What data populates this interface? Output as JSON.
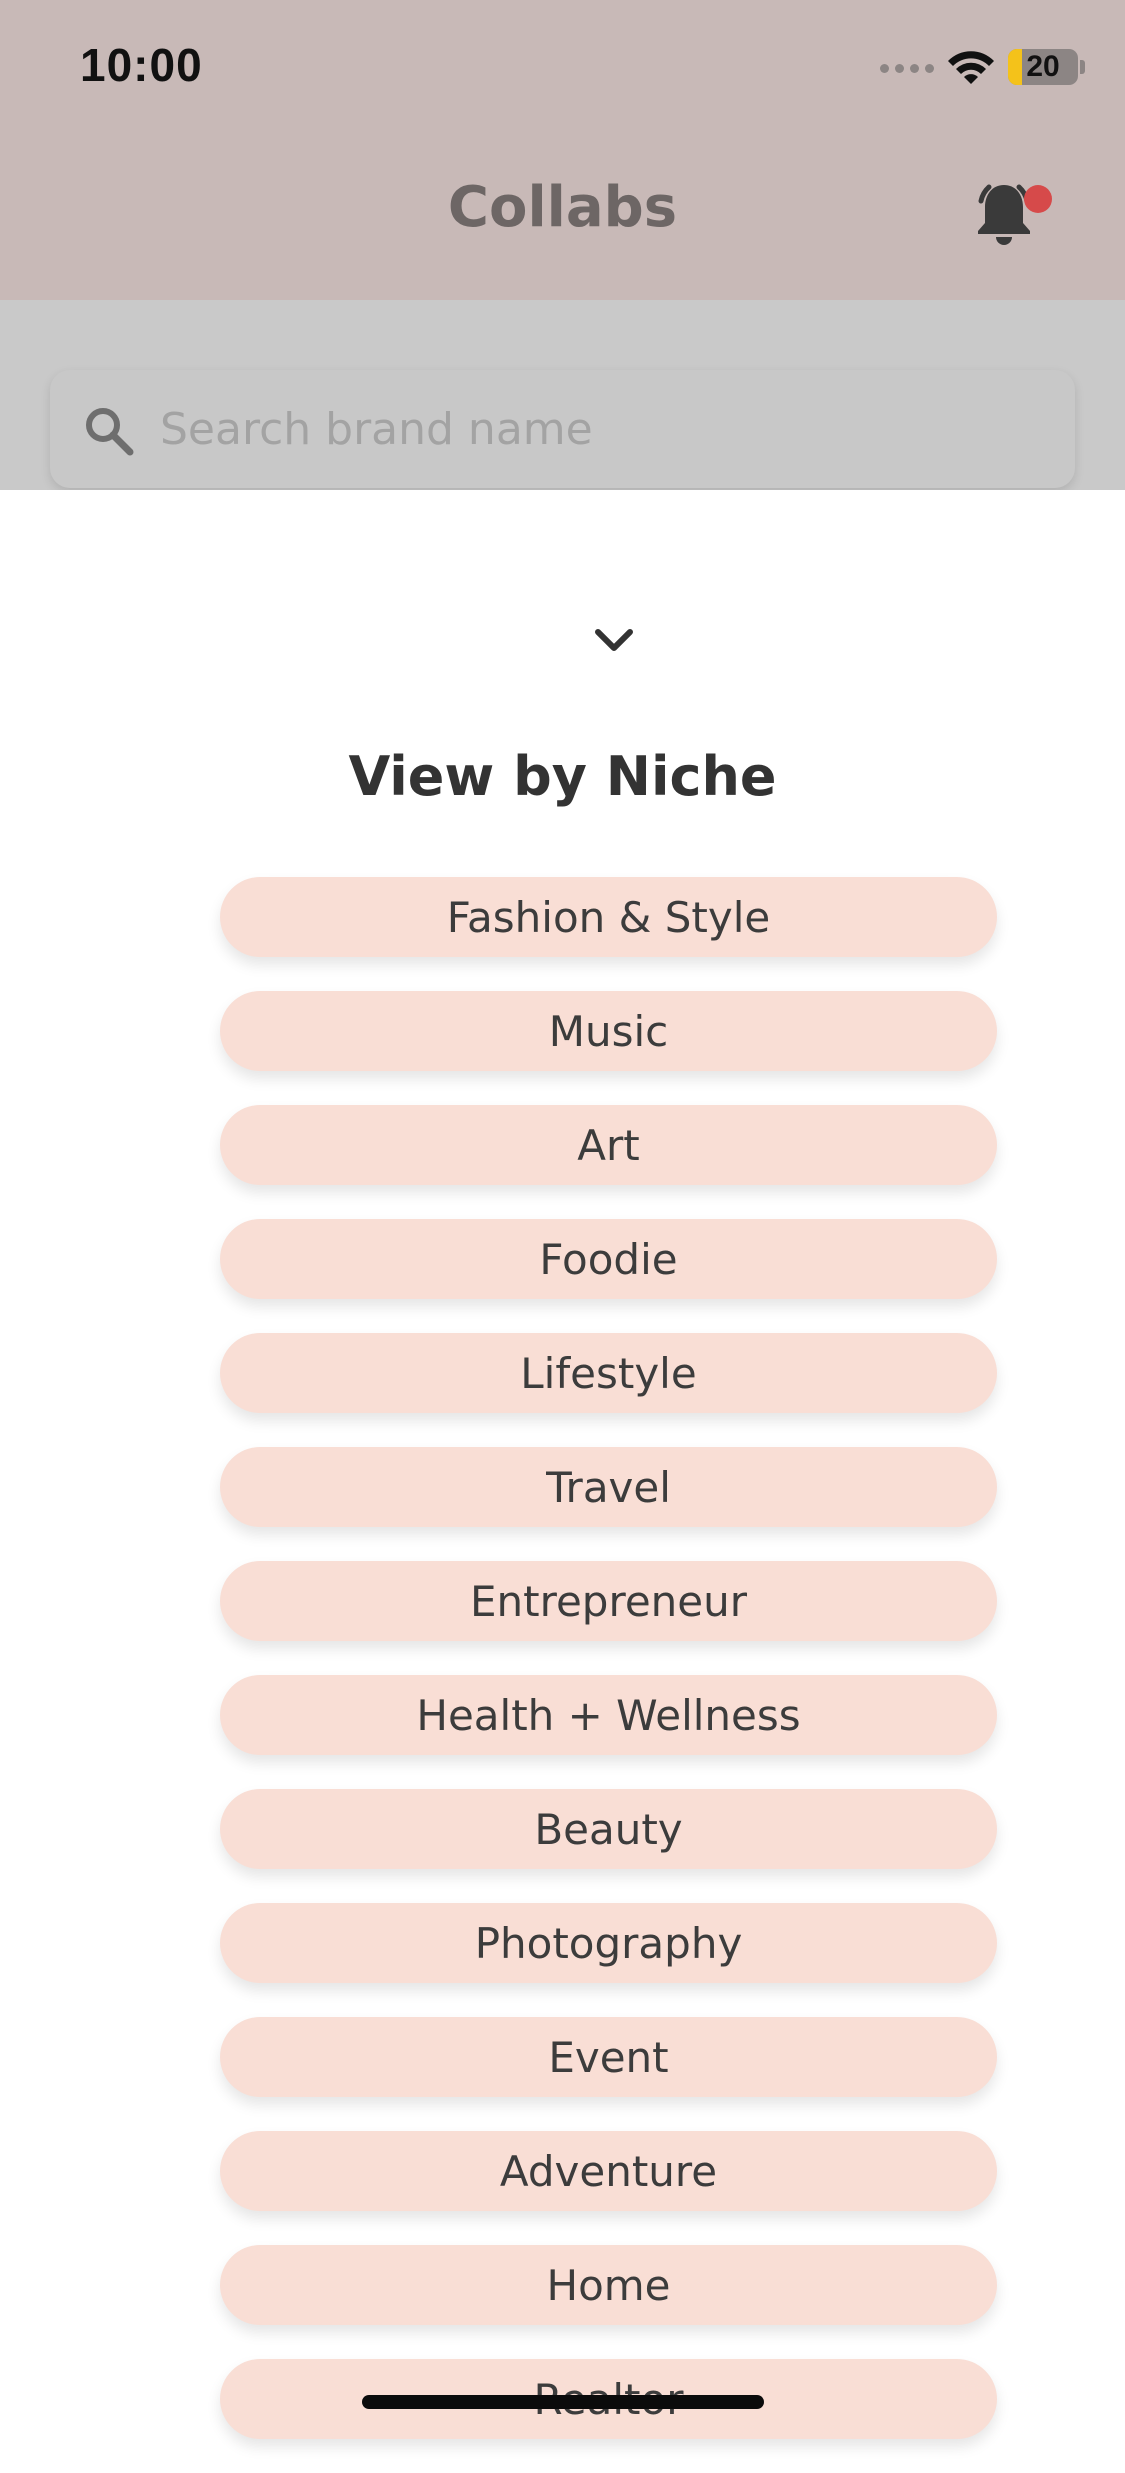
{
  "status_bar": {
    "time": "10:00",
    "battery": "20",
    "battery_fraction": 0.2,
    "icons": [
      "signal-dots-icon",
      "wifi-icon",
      "battery-icon"
    ]
  },
  "header": {
    "title": "Collabs",
    "notification_icon": "bell-icon",
    "has_unread": true,
    "badge_color": "#d64a4a"
  },
  "search": {
    "placeholder": "Search brand name",
    "icon": "search-icon"
  },
  "sheet": {
    "collapse_icon": "chevron-down-icon",
    "title": "View by Niche",
    "niches": [
      "Fashion & Style",
      "Music",
      "Art",
      "Foodie",
      "Lifestyle",
      "Travel",
      "Entrepreneur",
      "Health + Wellness",
      "Beauty",
      "Photography",
      "Event",
      "Adventure",
      "Home",
      "Realtor"
    ]
  },
  "colors": {
    "header_bg": "#c8b9b7",
    "pill_bg": "#f9ded5",
    "title_text": "#333333"
  }
}
